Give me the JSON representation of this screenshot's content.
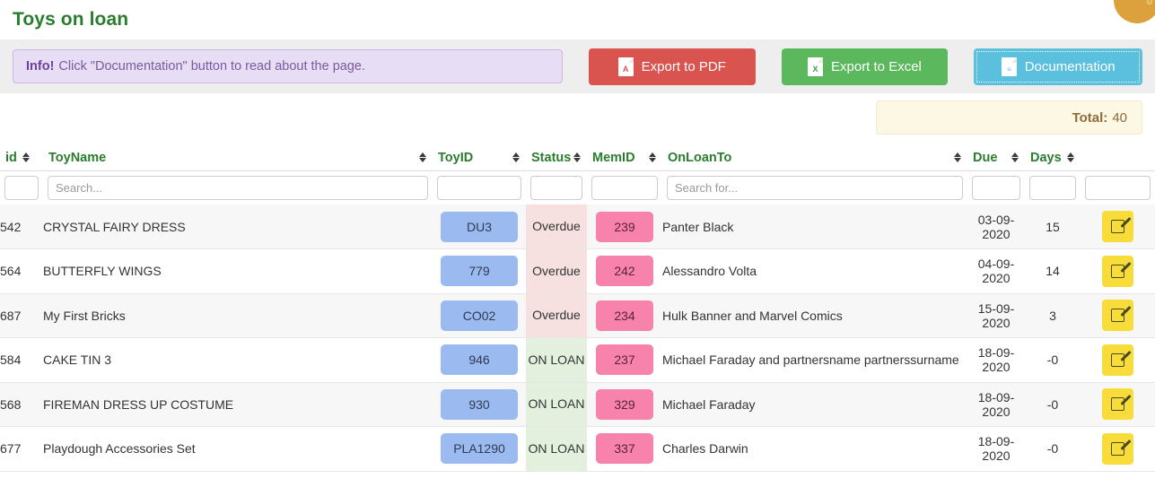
{
  "page": {
    "title": "Toys on loan"
  },
  "alert": {
    "strong": "Info!",
    "text": " Click \"Documentation\" button to read about the page."
  },
  "toolbar": {
    "export_pdf_label": "Export to PDF",
    "export_pdf_icon": "pdf-file-icon",
    "export_pdf_icon_text": "A",
    "export_pdf_color": "#d9534f",
    "export_excel_label": "Export to Excel",
    "export_excel_icon": "excel-file-icon",
    "export_excel_icon_text": "X",
    "export_excel_color": "#5cb85c",
    "documentation_label": "Documentation",
    "documentation_icon": "document-icon",
    "documentation_icon_text": "≡",
    "documentation_color": "#5bc0de"
  },
  "total": {
    "label": "Total:",
    "value": "40"
  },
  "table": {
    "columns": [
      {
        "key": "id",
        "label": "id",
        "sortable": true
      },
      {
        "key": "toyname",
        "label": "ToyName",
        "sortable": true
      },
      {
        "key": "toyid",
        "label": "ToyID",
        "sortable": true
      },
      {
        "key": "status",
        "label": "Status",
        "sortable": true
      },
      {
        "key": "memid",
        "label": "MemID",
        "sortable": true
      },
      {
        "key": "onloanto",
        "label": "OnLoanTo",
        "sortable": true
      },
      {
        "key": "due",
        "label": "Due",
        "sortable": true
      },
      {
        "key": "days",
        "label": "Days",
        "sortable": true
      },
      {
        "key": "actions",
        "label": "",
        "sortable": false
      }
    ],
    "filters": {
      "id": "",
      "toyname_placeholder": "Search...",
      "toyname": "",
      "toyid": "",
      "status": "",
      "memid": "",
      "onloanto_placeholder": "Search for...",
      "onloanto": "",
      "due": "",
      "days": "",
      "actions": ""
    },
    "rows": [
      {
        "id": "542",
        "toyname": "CRYSTAL FAIRY DRESS",
        "toyid": "DU3",
        "status": "Overdue",
        "status_kind": "overdue",
        "memid": "239",
        "onloanto": "Panter Black",
        "due": "03-09-2020",
        "days": "15",
        "action_icon": "edit-icon"
      },
      {
        "id": "564",
        "toyname": "BUTTERFLY WINGS",
        "toyid": "779",
        "status": "Overdue",
        "status_kind": "overdue",
        "memid": "242",
        "onloanto": "Alessandro Volta",
        "due": "04-09-2020",
        "days": "14",
        "action_icon": "edit-icon"
      },
      {
        "id": "687",
        "toyname": "My First Bricks",
        "toyid": "CO02",
        "status": "Overdue",
        "status_kind": "overdue",
        "memid": "234",
        "onloanto": "Hulk Banner and Marvel Comics",
        "due": "15-09-2020",
        "days": "3",
        "action_icon": "edit-icon"
      },
      {
        "id": "584",
        "toyname": "CAKE TIN 3",
        "toyid": "946",
        "status": "ON LOAN",
        "status_kind": "onloan",
        "memid": "237",
        "onloanto": "Michael Faraday and partnersname partnerssurname",
        "due": "18-09-2020",
        "days": "-0",
        "action_icon": "edit-icon"
      },
      {
        "id": "568",
        "toyname": "FIREMAN DRESS UP COSTUME",
        "toyid": "930",
        "status": "ON LOAN",
        "status_kind": "onloan",
        "memid": "329",
        "onloanto": "Michael Faraday",
        "due": "18-09-2020",
        "days": "-0",
        "action_icon": "edit-icon"
      },
      {
        "id": "677",
        "toyname": "Playdough Accessories Set",
        "toyid": "PLA1290",
        "status": "ON LOAN",
        "status_kind": "onloan",
        "memid": "337",
        "onloanto": "Charles Darwin",
        "due": "18-09-2020",
        "days": "-0",
        "action_icon": "edit-icon"
      }
    ]
  },
  "colors": {
    "title_green": "#2a7d2e",
    "alert_bg": "#e7ddf4",
    "pdf_red": "#d9534f",
    "excel_green": "#5cb85c",
    "doc_blue": "#5bc0de",
    "total_bg": "#fcf8e3",
    "toyid_pill": "#9bbaf0",
    "memid_pill": "#f782ab",
    "overdue_bg": "#f7e0e0",
    "onloan_bg": "#e2f0dd",
    "edit_yellow": "#f7dc3a",
    "corner_circle": "#dca03c"
  }
}
